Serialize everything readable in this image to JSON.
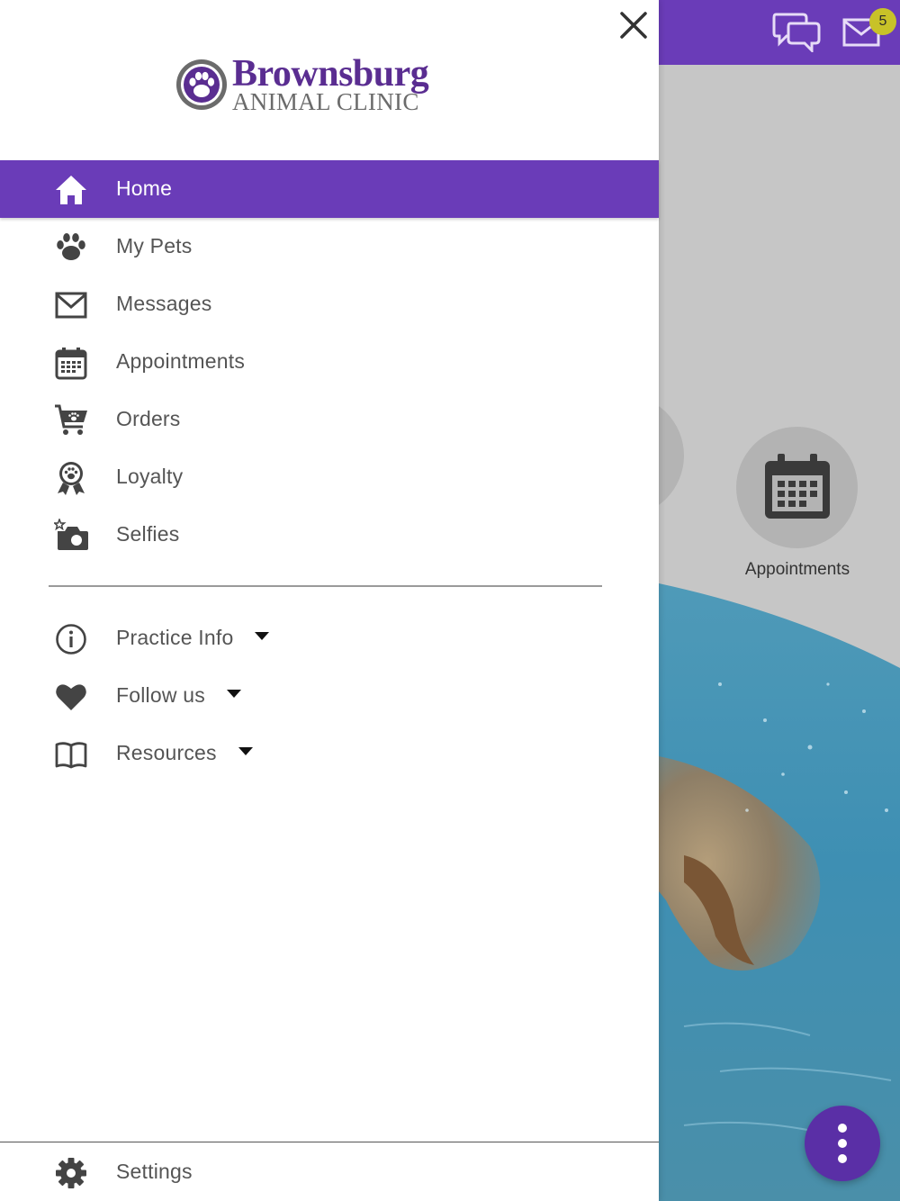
{
  "background": {
    "notification_count": "5",
    "appointments_label": "Appointments",
    "icons": {
      "chat": "chat-bubbles-icon",
      "mail": "mail-icon",
      "calendar": "calendar-icon",
      "menu": "more-vertical-icon"
    },
    "colors": {
      "brand_purple": "#6a3cb8",
      "badge_yellow": "#c8c228"
    }
  },
  "drawer": {
    "logo": {
      "title": "Brownsburg",
      "subtitle": "ANIMAL CLINIC"
    },
    "close_icon": "close-icon",
    "menu": [
      {
        "label": "Home",
        "icon": "home-icon",
        "active": true
      },
      {
        "label": "My Pets",
        "icon": "paw-icon"
      },
      {
        "label": "Messages",
        "icon": "envelope-icon"
      },
      {
        "label": "Appointments",
        "icon": "calendar-icon"
      },
      {
        "label": "Orders",
        "icon": "cart-icon"
      },
      {
        "label": "Loyalty",
        "icon": "award-ribbon-icon"
      },
      {
        "label": "Selfies",
        "icon": "camera-star-icon"
      }
    ],
    "secondary_menu": [
      {
        "label": "Practice Info",
        "icon": "info-icon",
        "expandable": true
      },
      {
        "label": "Follow us",
        "icon": "heart-icon",
        "expandable": true
      },
      {
        "label": "Resources",
        "icon": "book-icon",
        "expandable": true
      }
    ],
    "settings": {
      "label": "Settings",
      "icon": "gear-icon"
    }
  }
}
